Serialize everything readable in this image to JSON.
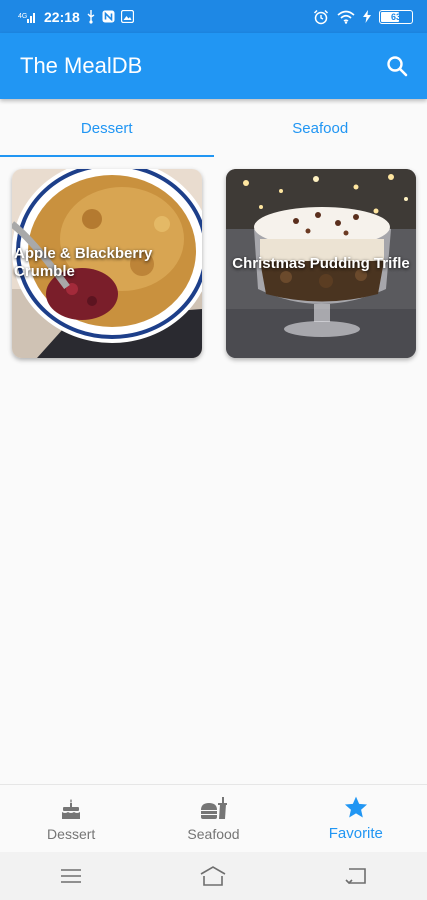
{
  "status_bar": {
    "signal_label": "4G",
    "time": "22:18",
    "battery_percent": "63",
    "battery_level": 0.63,
    "icons": [
      "signal-icon",
      "usb-icon",
      "notification-icon",
      "gallery-icon",
      "alarm-icon",
      "wifi-icon",
      "charging-icon",
      "battery-icon"
    ]
  },
  "app_bar": {
    "title": "The MealDB",
    "search_icon": "search-icon"
  },
  "tabs": [
    {
      "label": "Dessert",
      "active": true
    },
    {
      "label": "Seafood",
      "active": false
    }
  ],
  "meals": [
    {
      "name": "Apple & Blackberry Crumble"
    },
    {
      "name": "Christmas Pudding Trifle"
    }
  ],
  "bottom_nav": [
    {
      "label": "Dessert",
      "icon": "cake-icon",
      "active": false
    },
    {
      "label": "Seafood",
      "icon": "fastfood-icon",
      "active": false
    },
    {
      "label": "Favorite",
      "icon": "star-icon",
      "active": true
    }
  ],
  "system_nav": [
    "menu-icon",
    "home-icon",
    "back-icon"
  ],
  "colors": {
    "primary": "#2196f3",
    "status_bar": "#1e88e5",
    "inactive": "#757575",
    "background": "#fafafa"
  }
}
